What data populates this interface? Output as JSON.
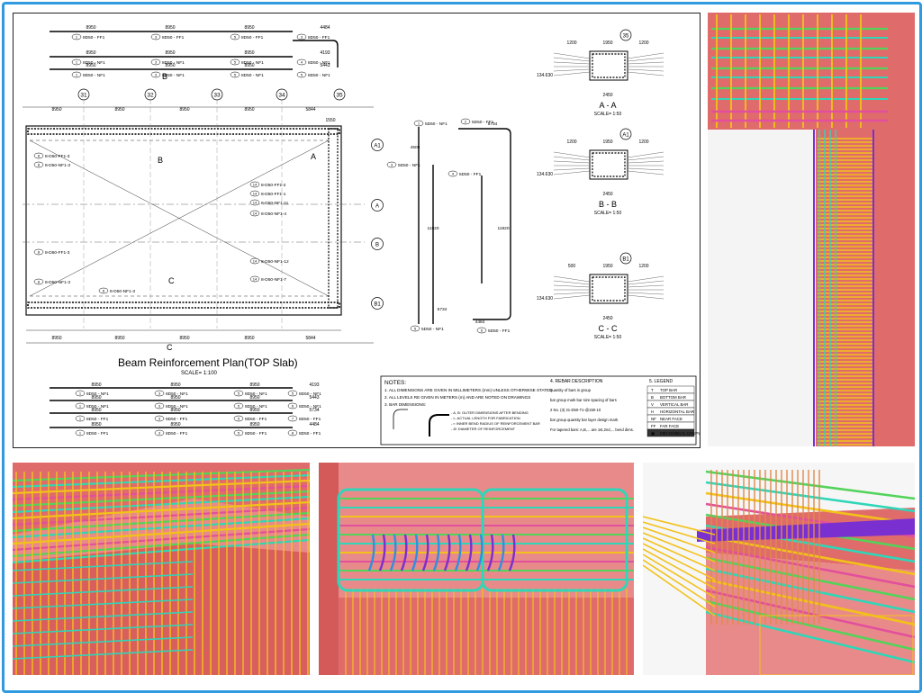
{
  "plan": {
    "title": "Beam Reinforcement Plan(TOP Slab)",
    "scale": "SCALE= 1:100",
    "grids_top": [
      "31",
      "32",
      "33",
      "34",
      "35"
    ],
    "grid_bottom_left": "C",
    "grid_right": [
      "A1",
      "A",
      "B",
      "B1"
    ],
    "dims_top": [
      "8950",
      "8950",
      "8950",
      "8950",
      "5844"
    ],
    "dims_bottom": [
      "8950",
      "8950",
      "8950",
      "8950",
      "5844"
    ],
    "dim_1550": "1550",
    "bar_rows_top": [
      {
        "label": "8D50 - FF1",
        "dims": [
          "8950",
          "8950",
          "8950"
        ],
        "tail": "4484"
      },
      {
        "label": "8D50 - NF1",
        "dims": [
          "8950",
          "8950",
          "8950"
        ],
        "tail": "4193"
      },
      {
        "label": "8D50 - NF1",
        "dims": [
          "8950",
          "8950",
          "8950"
        ],
        "tail": "5443"
      }
    ],
    "bar_rows_bottom": [
      {
        "label": "8D50 - NF1",
        "dims": [
          "8950",
          "8950",
          "8950"
        ],
        "tail": "4193"
      },
      {
        "label": "8D50 - NF1",
        "dims": [
          "8950",
          "8950",
          "8950"
        ],
        "tail": "5443"
      },
      {
        "label": "8D50 - FF1",
        "dims": [
          "8950",
          "8950",
          "8950"
        ],
        "tail": "5734"
      },
      {
        "label": "8D50 - FF1",
        "dims": [
          "8950",
          "8950",
          "8950"
        ],
        "tail": "4484"
      }
    ],
    "callouts_left": [
      "8-D50-FF1-3",
      "8-D50-NF1-3",
      "8-D50-FF1-3",
      "8-D50-NF1-3",
      "8-D50-NF1-3"
    ],
    "callouts_right": [
      "8-D50-FF1-2",
      "8-D50-FF1-1",
      "8-D50-NF1-11",
      "8-D50-NF1-4",
      "8-D50-NF1-12",
      "8-D50-NF1-7"
    ],
    "section_marks": [
      "A",
      "B",
      "C"
    ]
  },
  "bars": {
    "labels": [
      "5D50 - NF1",
      "5D50 - FF1",
      "5D50 - NF1",
      "5D50 - FF1",
      "5D50 - NF1",
      "5D50 - FF1"
    ],
    "lengths": [
      "5734",
      "4500",
      "11820",
      "5734",
      "4484",
      "11820"
    ]
  },
  "sections": [
    {
      "title": "A - A",
      "scale": "SCALE= 1:50",
      "grid": "35",
      "dims_top": [
        "1200",
        "1950",
        "1200"
      ],
      "width": "2450",
      "level": "134.630"
    },
    {
      "title": "B - B",
      "scale": "SCALE= 1:50",
      "grid": "A1",
      "dims_top": [
        "1200",
        "1950",
        "1200"
      ],
      "width": "2450",
      "level": "134.630"
    },
    {
      "title": "C - C",
      "scale": "SCALE= 1:50",
      "grid": "B1",
      "dims_top": [
        "500",
        "1950",
        "1200"
      ],
      "width": "2450",
      "level": "134.630"
    }
  ],
  "notes": {
    "heading": "NOTES:",
    "items": [
      "1. ALL DIMENSIONS ARE GIVEN IN MILLIMETERS (mm) UNLESS OTHERWISE STATED",
      "2. ALL LEVELS RE GIVEN IN METERS (m) AND ARE NOTED ON DRAWINGS",
      "3. BAR DIMENSIONS:"
    ],
    "bar_dim_items": [
      "- A, B: OUTER DIMENSIONS AFTER BENDING",
      "- L: ACTUAL LENGTH FOR FABRICATION",
      "- r: INNER BEND RADIUS OF REINFORCEMENT BAR",
      "- Ø: DIAMETER OF REINFORCEMENT"
    ],
    "rebar_heading": "4. REBAR DESCRIPTION",
    "rebar_lines": [
      "quantity of bars in group",
      "bar group mark    bar size    spacing of bars",
      "2 No. (3) 21-D50-T1-@150-10",
      "bar group quantity    bar layer    design mark",
      "For tapered bars: A,B,... are 1st,2nd,... bend dims."
    ],
    "legend_heading": "5. LEGEND",
    "legend": [
      {
        "code": "T",
        "text": "TOP BAR"
      },
      {
        "code": "B",
        "text": "BOTTOM BAR"
      },
      {
        "code": "V",
        "text": "VERTICAL BAR"
      },
      {
        "code": "H",
        "text": "HORIZONTAL BAR"
      },
      {
        "code": "NF",
        "text": "NEAR FACE"
      },
      {
        "code": "FF",
        "text": "FAR FACE"
      },
      {
        "code": "▣",
        "text": "MECHANICAL COUPLING"
      }
    ]
  },
  "colors": {
    "frame": "#2f9ae0",
    "concrete": "#e06b6b",
    "bar_yellow": "#f2c21a",
    "bar_teal": "#2fd6b8",
    "bar_green": "#52d35a",
    "bar_purple": "#7a2fd0",
    "bar_pink": "#e24f9c"
  }
}
